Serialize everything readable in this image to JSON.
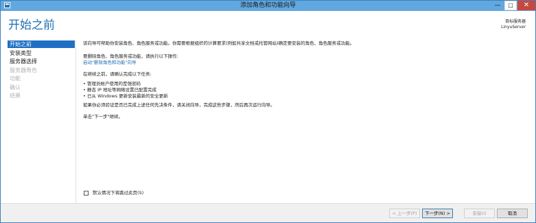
{
  "window": {
    "title": "添加角色和功能向导",
    "minimize": "—",
    "maximize": "□",
    "close": "✕"
  },
  "page": {
    "title": "开始之前"
  },
  "server": {
    "label": "目标服务器",
    "name": "LinyuServer"
  },
  "sidebar": {
    "items": [
      {
        "label": "开始之前",
        "state": "active"
      },
      {
        "label": "安装类型",
        "state": "normal"
      },
      {
        "label": "服务器选择",
        "state": "normal"
      },
      {
        "label": "服务器角色",
        "state": "disabled"
      },
      {
        "label": "功能",
        "state": "disabled"
      },
      {
        "label": "确认",
        "state": "disabled"
      },
      {
        "label": "结果",
        "state": "disabled"
      }
    ]
  },
  "content": {
    "intro": "该向导可帮助你安装角色、角色服务或功能。你需要根据组织的计算要求(例如共享文档或托管网站)确定要安装的角色、角色服务或功能。",
    "remove_prompt": "要删除角色、角色服务或功能，请执行以下操作:",
    "remove_link": "启动\"删除角色和功能\"向导",
    "before_title": "在继续之前，请确认完成以下任务:",
    "tasks": [
      "管理员帐户使用的是强密码",
      "静态 IP 地址等网络设置已配置完成",
      "已从 Windows 更新安装最新的安全更新"
    ],
    "verify": "如果你必须验证是否已完成上述任何先决条件，请关闭向导，完成这些步骤，然后再次运行向导。",
    "continue": "单击\"下一步\"继续。"
  },
  "skip_checkbox": {
    "label": "默认情况下将跳过此页(S)",
    "checked": false
  },
  "footer": {
    "prev": "< 上一步(P)",
    "next": "下一步(N) >",
    "install": "安装(I)",
    "cancel": "取消"
  },
  "colors": {
    "titlebar": "#62a8e0",
    "accent": "#1f6fb5",
    "active_nav": "#1f6fc4",
    "close_button": "#c7473d"
  }
}
